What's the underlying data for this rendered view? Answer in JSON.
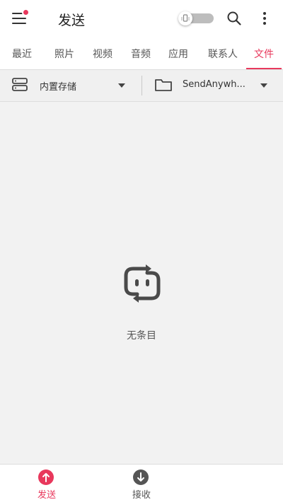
{
  "app_bar": {
    "title": "发送",
    "menu_icon": "menu-icon",
    "notification_dot_color": "#e8385c",
    "toggle_state": "off",
    "search_icon": "search-icon",
    "more_icon": "more-vertical-icon"
  },
  "tabs": [
    {
      "label": "最近",
      "active": false
    },
    {
      "label": "照片",
      "active": false
    },
    {
      "label": "视频",
      "active": false
    },
    {
      "label": "音频",
      "active": false
    },
    {
      "label": "应用",
      "active": false
    },
    {
      "label": "联系人",
      "active": false
    },
    {
      "label": "文件",
      "active": true
    }
  ],
  "path_bar": {
    "storage": {
      "label": "内置存储",
      "icon": "storage-icon"
    },
    "folder": {
      "label": "SendAnywh...",
      "icon": "folder-icon"
    }
  },
  "empty_state": {
    "icon": "transfer-logo-icon",
    "message": "无条目"
  },
  "bottom_nav": {
    "items": [
      {
        "label": "发送",
        "icon": "upload-arrow-icon",
        "active": true
      },
      {
        "label": "接收",
        "icon": "download-arrow-icon",
        "active": false
      }
    ]
  },
  "colors": {
    "accent": "#e8385c",
    "background": "#f2f2f2",
    "surface": "#ffffff"
  }
}
